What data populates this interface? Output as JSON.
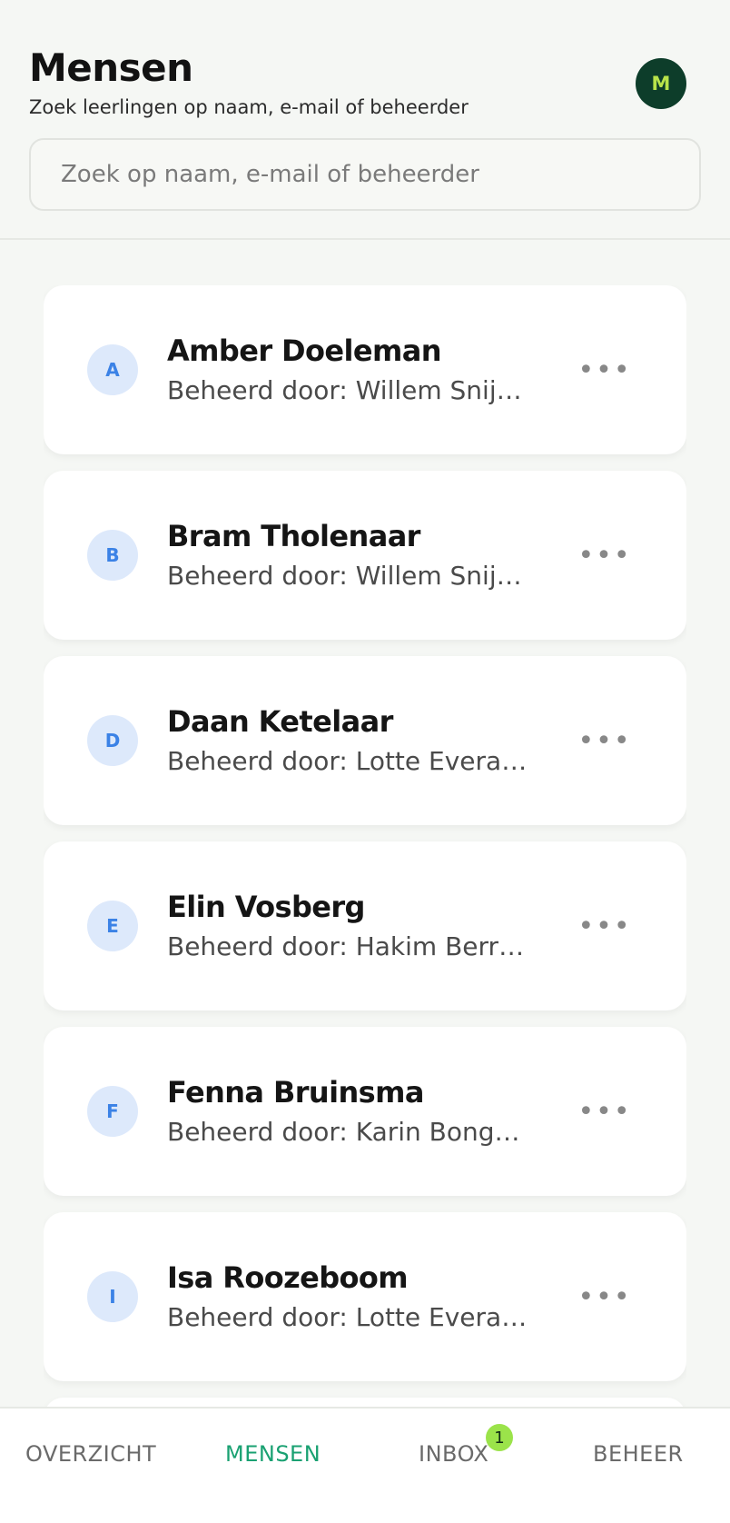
{
  "header": {
    "title": "Mensen",
    "subtitle": "Zoek leerlingen op naam, e-mail of beheerder",
    "avatar_initial": "M"
  },
  "search": {
    "placeholder": "Zoek op naam, e-mail of beheerder",
    "value": ""
  },
  "people": [
    {
      "initial": "A",
      "name": "Amber Doeleman",
      "managed_by": "Beheerd door: Willem Snijd…"
    },
    {
      "initial": "B",
      "name": "Bram Tholenaar",
      "managed_by": "Beheerd door: Willem Snijd…"
    },
    {
      "initial": "D",
      "name": "Daan Ketelaar",
      "managed_by": "Beheerd door: Lotte Everaers"
    },
    {
      "initial": "E",
      "name": "Elin Vosberg",
      "managed_by": "Beheerd door: Hakim Berra…"
    },
    {
      "initial": "F",
      "name": "Fenna Bruinsma",
      "managed_by": "Beheerd door: Karin Bongers"
    },
    {
      "initial": "I",
      "name": "Isa Roozeboom",
      "managed_by": "Beheerd door: Lotte Everaers"
    }
  ],
  "more_icon": "more-horizontal-icon",
  "tabs": {
    "overzicht": "OVERZICHT",
    "mensen": "MENSEN",
    "inbox": "INBOX",
    "inbox_badge": "1",
    "beheer": "BEHEER",
    "active": "MENSEN"
  },
  "colors": {
    "accent": "#1aa172",
    "avatar_bg": "#0d3d2a",
    "avatar_fg": "#b8e34a",
    "badge": "#9be34a",
    "initial_bg": "#dde9fb",
    "initial_fg": "#3b82e6"
  }
}
